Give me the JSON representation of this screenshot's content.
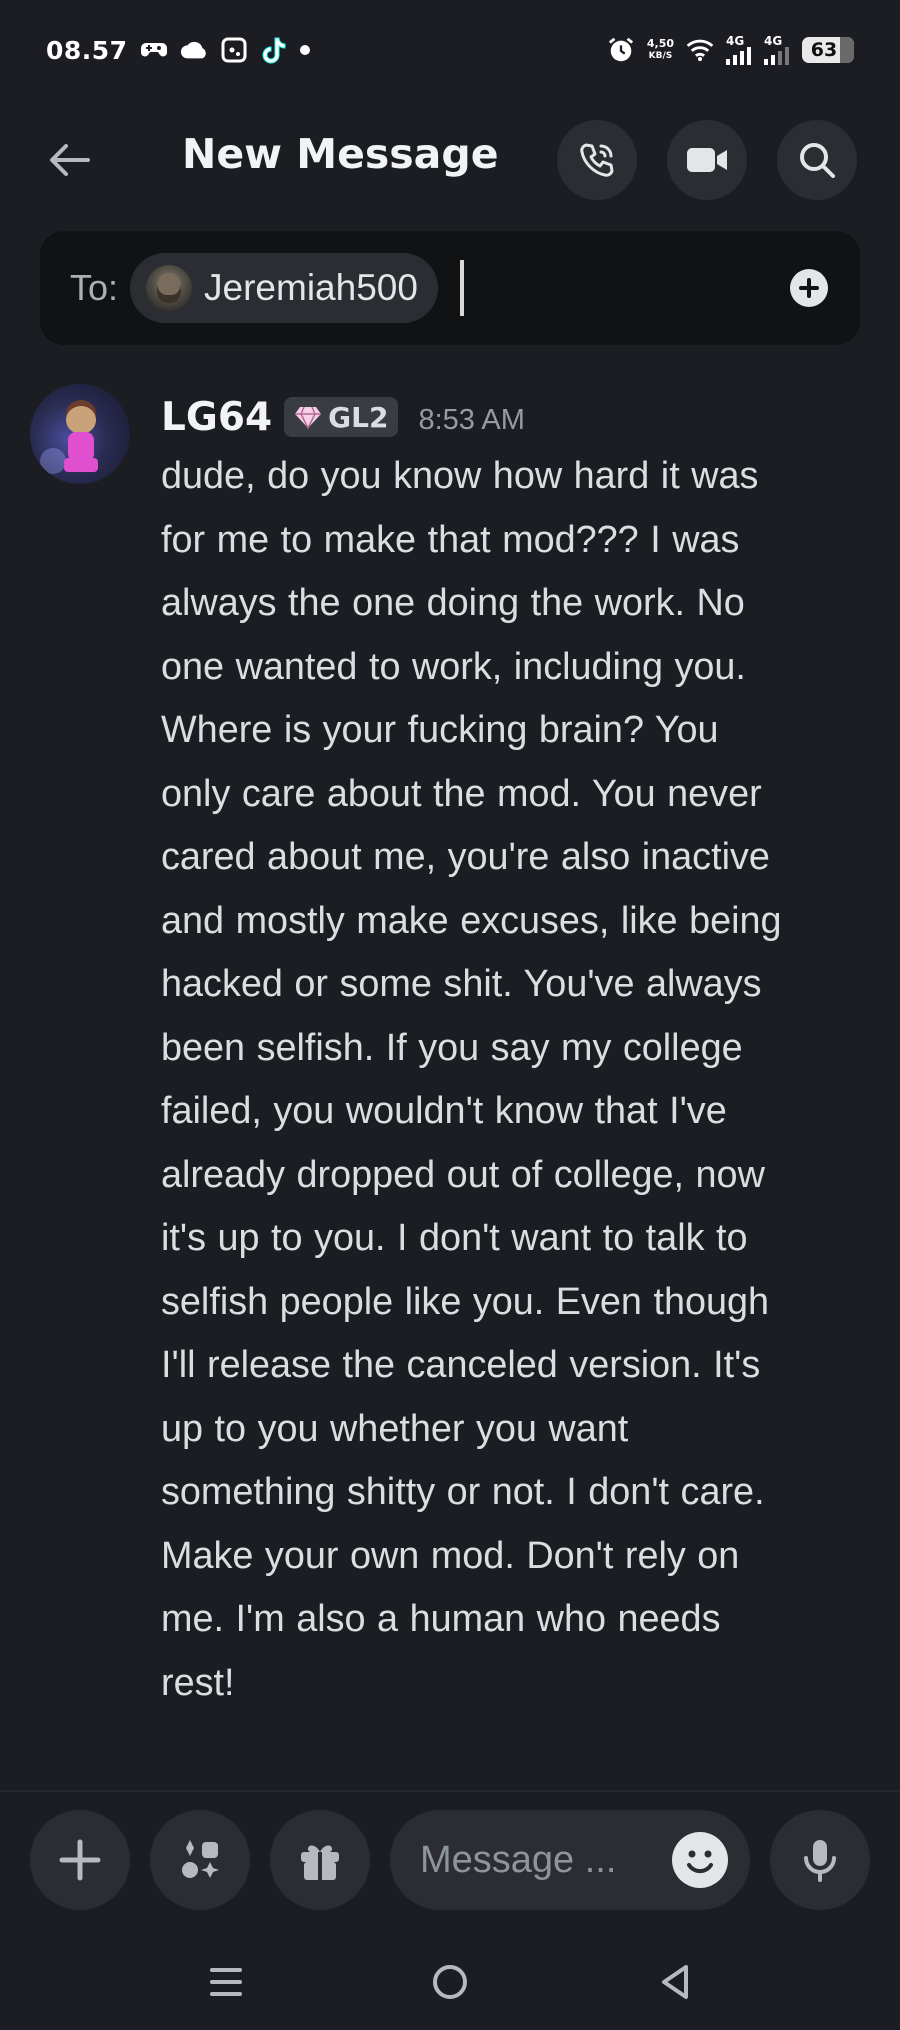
{
  "status_bar": {
    "time": "08.57",
    "net_speed_value": "4,50",
    "net_speed_unit": "KB/S",
    "signal1": "4G",
    "signal2": "4G",
    "battery": "63"
  },
  "header": {
    "title": "New Message"
  },
  "recipient_bar": {
    "to_label": "To:",
    "recipient_name": "Jeremiah500"
  },
  "message": {
    "username": "LG64",
    "guild_tag": "GL2",
    "timestamp": "8:53 AM",
    "lines": [
      "dude, do you know how hard it was",
      "for me to make that mod??? I was",
      "always the one doing the work. No",
      "one wanted to work, including you.",
      "Where is your fucking brain? You",
      "only care about the mod. You never",
      "cared about me, you're also inactive",
      "and mostly make excuses, like being",
      "hacked or some shit. You've always",
      "been selfish. If you say my college",
      "failed, you wouldn't know that I've",
      "already dropped out of college, now",
      "it's up to you. I don't want to talk to",
      "selfish people like you. Even though",
      "I'll release the canceled version. It's",
      "up to you whether you want",
      "something shitty or not. I don't care.",
      "Make your own mod. Don't rely on",
      "me. I'm also a human who needs",
      "rest!"
    ]
  },
  "composer": {
    "placeholder": "Message ..."
  },
  "colors": {
    "background": "#1c1d22",
    "surface": "#2b2d33",
    "to_bar": "#111214",
    "text": "#dbdee1",
    "muted": "#949ba4"
  }
}
